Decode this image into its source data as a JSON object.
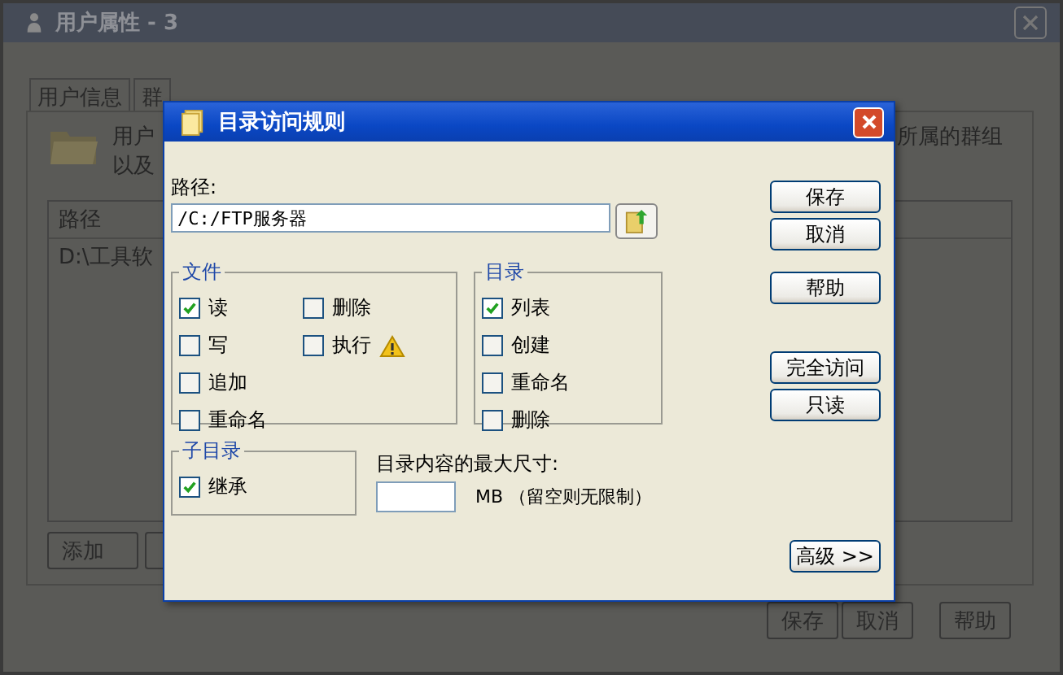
{
  "window": {
    "title": "用户属性 - 3"
  },
  "tabs": [
    {
      "label": "用户信息",
      "selected": false
    },
    {
      "label": "群",
      "selected": false
    }
  ],
  "intro_left": [
    "用户",
    "以及"
  ],
  "intro_right": "所属的群组",
  "rules_table": {
    "columns": [
      "路径"
    ],
    "rows": [
      "D:\\工具软"
    ]
  },
  "panel_buttons": [
    "添加"
  ],
  "footer_buttons": [
    "保存",
    "取消",
    "帮助"
  ],
  "dialog": {
    "title": "目录访问规则",
    "path_label": "路径:",
    "path_value": "/C:/FTP服务器",
    "groups": [
      {
        "title": "文件",
        "items": [
          {
            "label": "读",
            "checked": true,
            "warning": false
          },
          {
            "label": "写",
            "checked": false,
            "warning": false
          },
          {
            "label": "追加",
            "checked": false,
            "warning": false
          },
          {
            "label": "重命名",
            "checked": false,
            "warning": false
          },
          {
            "label": "删除",
            "checked": false,
            "warning": false
          },
          {
            "label": "执行",
            "checked": false,
            "warning": true
          }
        ]
      },
      {
        "title": "目录",
        "items": [
          {
            "label": "列表",
            "checked": true,
            "warning": false
          },
          {
            "label": "创建",
            "checked": false,
            "warning": false
          },
          {
            "label": "重命名",
            "checked": false,
            "warning": false
          },
          {
            "label": "删除",
            "checked": false,
            "warning": false
          }
        ]
      }
    ],
    "subdir": {
      "title": "子目录",
      "items": [
        {
          "label": "继承",
          "checked": true,
          "warning": false
        }
      ]
    },
    "size_label": "目录内容的最大尺寸:",
    "size_note": "MB （留空则无限制）",
    "button_groups": [
      [
        "保存",
        "取消"
      ],
      [
        "帮助"
      ],
      [
        "完全访问",
        "只读"
      ]
    ],
    "advanced_button": "高级 >>"
  }
}
